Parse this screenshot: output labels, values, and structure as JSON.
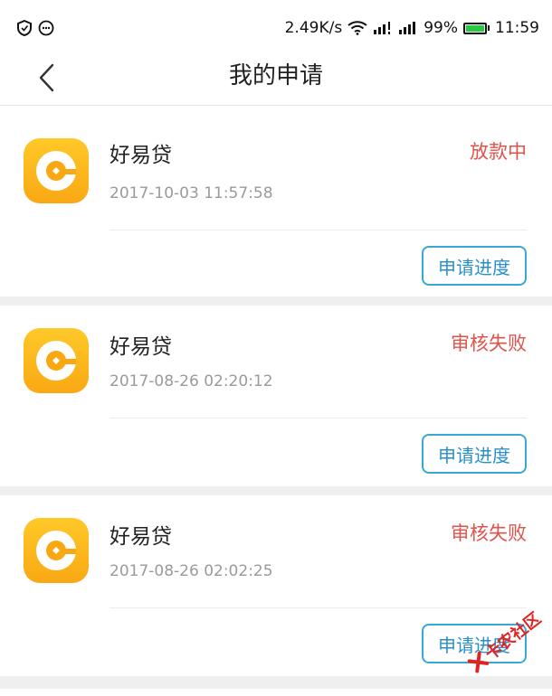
{
  "status_bar": {
    "speed": "2.49K/s",
    "battery": "99%",
    "time": "11:59"
  },
  "header": {
    "title": "我的申请"
  },
  "applications": [
    {
      "app_name": "好易贷",
      "date": "2017-10-03 11:57:58",
      "status": "放款中",
      "button_label": "申请进度"
    },
    {
      "app_name": "好易贷",
      "date": "2017-08-26 02:20:12",
      "status": "审核失败",
      "button_label": "申请进度"
    },
    {
      "app_name": "好易贷",
      "date": "2017-08-26 02:02:25",
      "status": "审核失败",
      "button_label": "申请进度"
    }
  ],
  "watermark": {
    "text": "卡农社区"
  },
  "colors": {
    "status_red": "#e0534a",
    "button_blue": "#2b8fc6",
    "icon_yellow": "#ffc928"
  }
}
